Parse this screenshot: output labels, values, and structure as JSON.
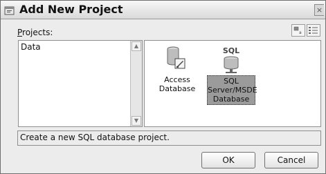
{
  "window": {
    "title": "Add New Project",
    "close_glyph": "×",
    "icon": "project-icon"
  },
  "projects": {
    "label_underlined": "P",
    "label_rest": "rojects:",
    "items": [
      "Data"
    ],
    "selected": "Data"
  },
  "view_toggle": {
    "large_icon": "large-icons-icon",
    "small_icon": "list-view-icon"
  },
  "templates": [
    {
      "label_line1": "Access",
      "label_line2": "Database",
      "label_line3": "",
      "icon": "access-database-icon",
      "selected": false
    },
    {
      "label_line1": "SQL",
      "label_line2": "Server/MSDE",
      "label_line3": "Database",
      "icon": "sql-database-icon",
      "icon_text": "SQL",
      "selected": true
    }
  ],
  "status": {
    "text": "Create a new SQL database project."
  },
  "buttons": {
    "ok": "OK",
    "cancel": "Cancel"
  }
}
